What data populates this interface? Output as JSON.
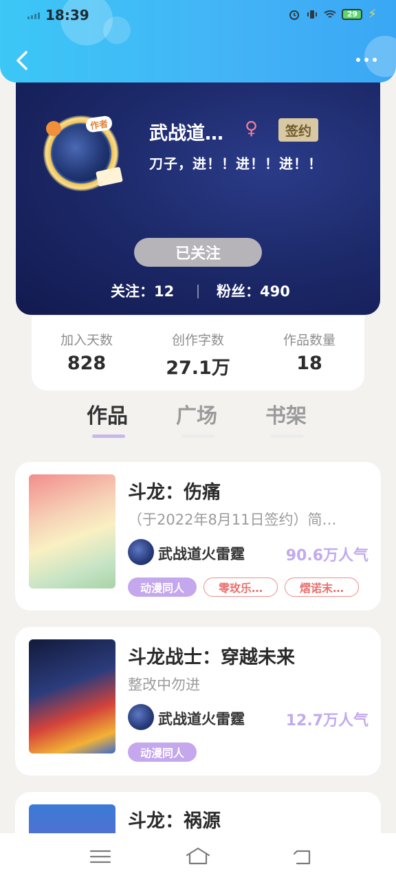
{
  "status_bar": {
    "time": "18:39",
    "battery": "29"
  },
  "profile": {
    "name": "武战道…",
    "gender_symbol": "♀",
    "badge": "签约",
    "author_tag": "作者",
    "motto": "刀子，进！！进！！进！！",
    "follow_button": "已关注",
    "following_label": "关注：12",
    "fans_label": "粉丝：490"
  },
  "stats": [
    {
      "label": "加入天数",
      "value": "828"
    },
    {
      "label": "创作字数",
      "value": "27.1万"
    },
    {
      "label": "作品数量",
      "value": "18"
    }
  ],
  "tabs": [
    {
      "label": "作品",
      "active": true
    },
    {
      "label": "广场",
      "active": false
    },
    {
      "label": "书架",
      "active": false
    }
  ],
  "works": [
    {
      "title": "斗龙：伤痛",
      "desc": "（于2022年8月11日签约）简…",
      "author": "武战道火雷霆",
      "popularity": "90.6万人气",
      "tags": [
        {
          "label": "动漫同人",
          "style": "filled"
        },
        {
          "label": "零玫乐…",
          "style": "outline"
        },
        {
          "label": "熠诺末…",
          "style": "outline"
        }
      ]
    },
    {
      "title": "斗龙战士：穿越未来",
      "desc": "整改中勿进",
      "author": "武战道火雷霆",
      "popularity": "12.7万人气",
      "tags": [
        {
          "label": "动漫同人",
          "style": "filled"
        }
      ]
    },
    {
      "title": "斗龙：祸源"
    }
  ],
  "colors": {
    "topbar": "#3cc7f6",
    "card_bg": "#1d2a6b",
    "accent_purple": "#c4a7ec",
    "tag_outline": "#ee8a88"
  },
  "icons": {
    "back": "chevron-left-icon",
    "more": "more-horizontal-icon",
    "nav": [
      "menu-icon",
      "home-icon",
      "back-icon"
    ]
  }
}
